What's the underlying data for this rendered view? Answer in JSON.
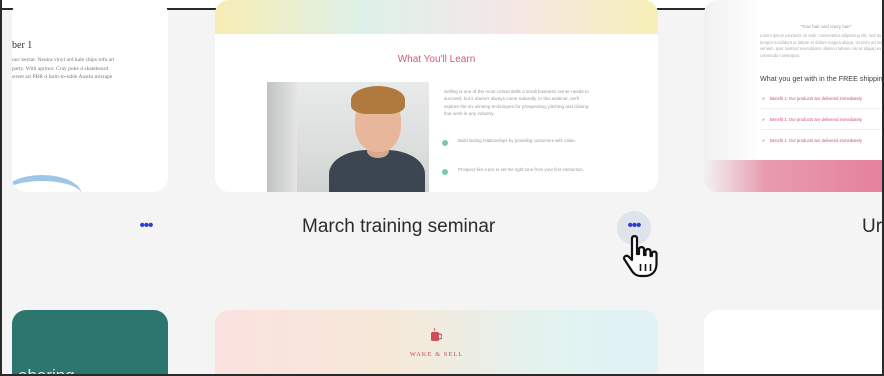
{
  "cards": [
    {
      "heading": "ber 1",
      "body": "unc keytar. Neutra vinyl ard kale chips tofu art party. With aprinor. Cray poke d skateboard street art PBR d farm-to-table Austin mixtape"
    },
    {
      "title": "March training seminar",
      "preview": {
        "heading": "What You'll Learn",
        "paragraph": "Selling is one of the most critical skills a small business owner needs to succeed, but it doesn't always come naturally. In this webinar, we'll explore the six winning techniques for prospecting, pitching and closing that work in any industry.",
        "bullets": [
          "Build lasting relationships by providing customers with value.",
          "Prospect like a pro to set the right tone from your first interaction."
        ]
      }
    },
    {
      "title": "Ur",
      "preview": {
        "quote": "\"Your hair and crazy hair\"",
        "paragraph": "Lorem ipsum products on sale: consectetur adipiscing elit, sed do eiusmod tempor incididunt ut labore et dolore magna aliqua. Ut enim ad minim veniam, quis nostrud exercitation ullamco laboris nisi ut aliquip ex ea commodo consequat.",
        "subheading": "What you get with in the FREE shipping",
        "items": [
          "Benefit 1: Our products are delivered immediately",
          "Benefit 1: Our products are delivered immediately",
          "Benefit 1: Our products are delivered immediately"
        ]
      }
    }
  ],
  "bottom_cards": [
    {
      "text": "ohering"
    },
    {
      "logo": "WAKE & SELL"
    },
    {}
  ],
  "more_button": {
    "dots": "•••"
  },
  "colors": {
    "accent": "#2e3fd0",
    "teal": "#2d756f",
    "pink": "#d45b70"
  },
  "icons": {
    "more": "ellipsis-icon",
    "cursor": "hand-pointer-icon",
    "check": "check-circle-icon",
    "mug": "coffee-mug-icon"
  }
}
